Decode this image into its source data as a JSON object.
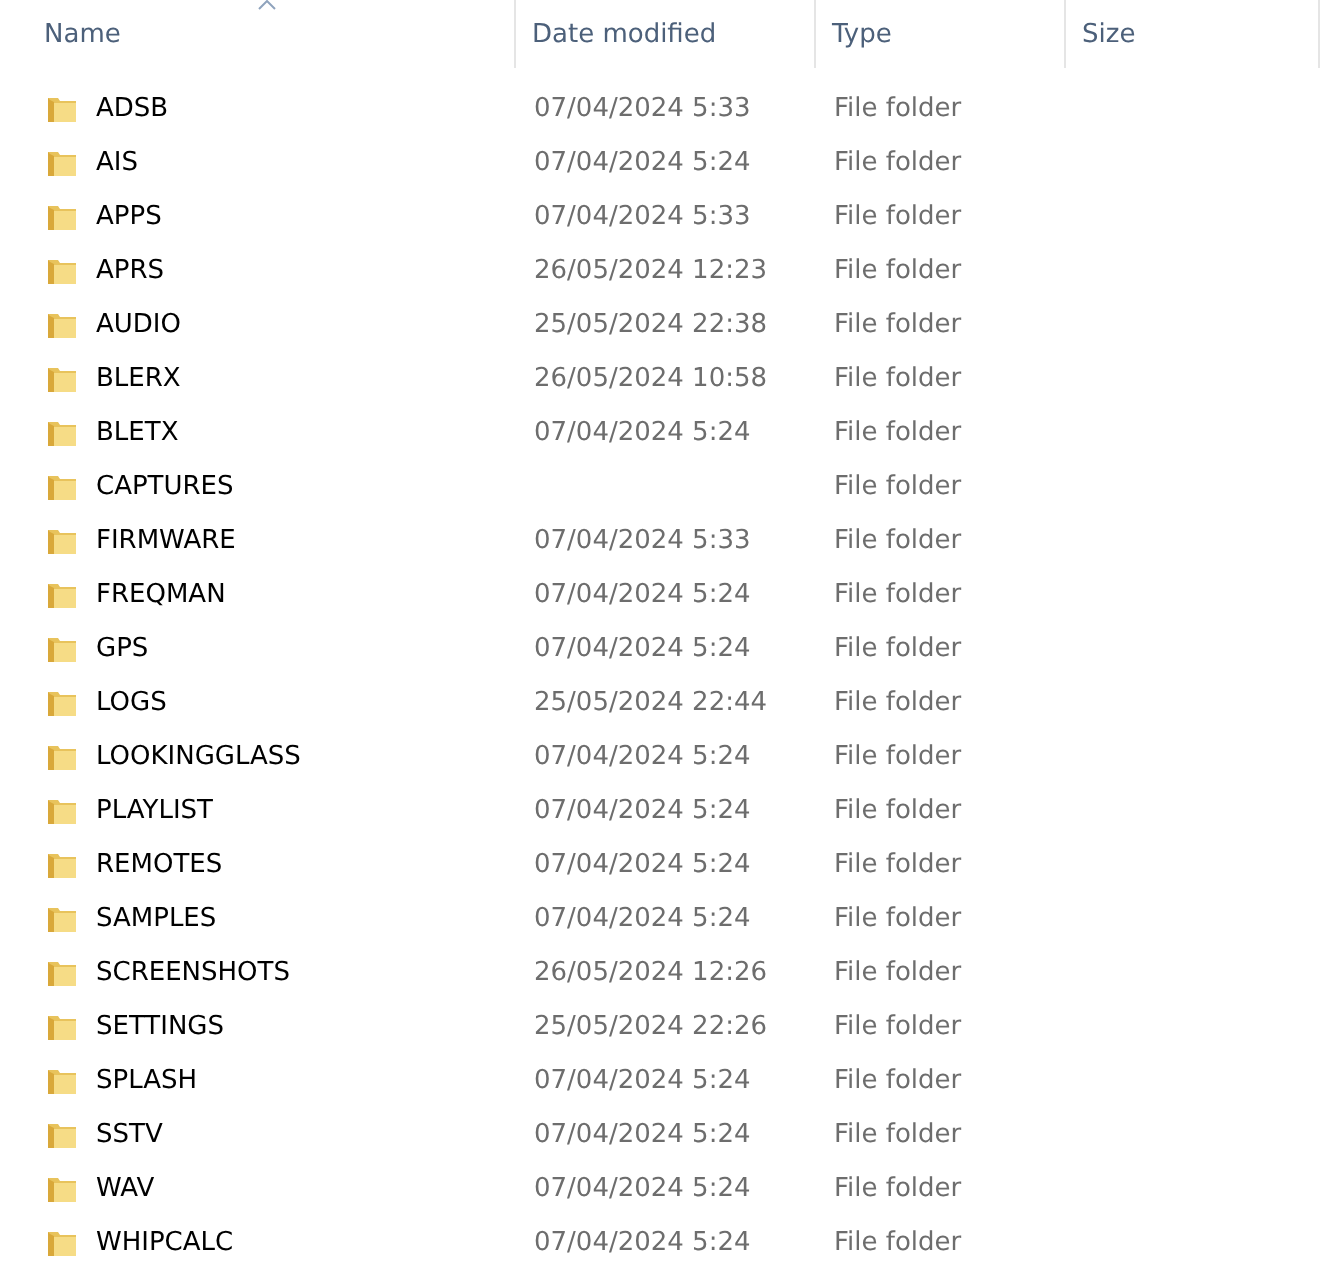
{
  "columns": [
    {
      "label": "Name",
      "sorted": true
    },
    {
      "label": "Date modified",
      "sorted": false
    },
    {
      "label": "Type",
      "sorted": false
    },
    {
      "label": "Size",
      "sorted": false
    }
  ],
  "rows": [
    {
      "name": "ADSB",
      "date": "07/04/2024 5:33",
      "type": "File folder"
    },
    {
      "name": "AIS",
      "date": "07/04/2024 5:24",
      "type": "File folder"
    },
    {
      "name": "APPS",
      "date": "07/04/2024 5:33",
      "type": "File folder"
    },
    {
      "name": "APRS",
      "date": "26/05/2024 12:23",
      "type": "File folder"
    },
    {
      "name": "AUDIO",
      "date": "25/05/2024 22:38",
      "type": "File folder"
    },
    {
      "name": "BLERX",
      "date": "26/05/2024 10:58",
      "type": "File folder"
    },
    {
      "name": "BLETX",
      "date": "07/04/2024 5:24",
      "type": "File folder"
    },
    {
      "name": "CAPTURES",
      "type": "File folder"
    },
    {
      "name": "FIRMWARE",
      "date": "07/04/2024 5:33",
      "type": "File folder"
    },
    {
      "name": "FREQMAN",
      "date": "07/04/2024 5:24",
      "type": "File folder"
    },
    {
      "name": "GPS",
      "date": "07/04/2024 5:24",
      "type": "File folder"
    },
    {
      "name": "LOGS",
      "date": "25/05/2024 22:44",
      "type": "File folder"
    },
    {
      "name": "LOOKINGGLASS",
      "date": "07/04/2024 5:24",
      "type": "File folder"
    },
    {
      "name": "PLAYLIST",
      "date": "07/04/2024 5:24",
      "type": "File folder"
    },
    {
      "name": "REMOTES",
      "date": "07/04/2024 5:24",
      "type": "File folder"
    },
    {
      "name": "SAMPLES",
      "date": "07/04/2024 5:24",
      "type": "File folder"
    },
    {
      "name": "SCREENSHOTS",
      "date": "26/05/2024 12:26",
      "type": "File folder"
    },
    {
      "name": "SETTINGS",
      "date": "25/05/2024 22:26",
      "type": "File folder"
    },
    {
      "name": "SPLASH",
      "date": "07/04/2024 5:24",
      "type": "File folder"
    },
    {
      "name": "SSTV",
      "date": "07/04/2024 5:24",
      "type": "File folder"
    },
    {
      "name": "WAV",
      "date": "07/04/2024 5:24",
      "type": "File folder"
    },
    {
      "name": "WHIPCALC",
      "date": "07/04/2024 5:24",
      "type": "File folder"
    }
  ]
}
